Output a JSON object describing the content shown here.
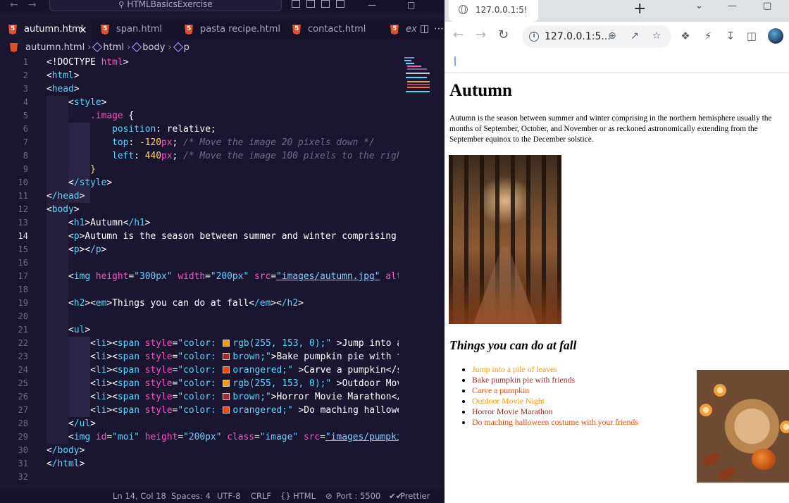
{
  "vscode": {
    "command_center": "HTMLBasicsExercise",
    "tabs": [
      {
        "label": "autumn.html",
        "active": true
      },
      {
        "label": "span.html"
      },
      {
        "label": "pasta recipe.html"
      },
      {
        "label": "contact.html"
      },
      {
        "label": "ex"
      }
    ],
    "breadcrumb": [
      "autumn.html",
      "html",
      "body",
      "p"
    ],
    "current_line": 14,
    "line_numbers": [
      "1",
      "2",
      "3",
      "4",
      "5",
      "6",
      "7",
      "8",
      "9",
      "10",
      "11",
      "12",
      "13",
      "14",
      "15",
      "16",
      "17",
      "18",
      "19",
      "20",
      "21",
      "22",
      "23",
      "24",
      "25",
      "26",
      "27",
      "28",
      "29",
      "30",
      "31",
      "32"
    ],
    "code": {
      "l1_doctype": "<!DOCTYPE",
      "l1_html": "html",
      "l1_close": ">",
      "l2": "html",
      "l3": "head",
      "l4": "style",
      "l5_sel": ".image",
      "l5_brace": " {",
      "l6_prop": "position",
      "l6_val": ": relative;",
      "l7_prop": "top",
      "l7_num": "-120",
      "l7_unit": "px",
      "l7_semi": ";",
      "l7_com": " /* Move the image 20 pixels down */",
      "l8_prop": "left",
      "l8_num": "440",
      "l8_unit": "px",
      "l8_semi": ";",
      "l8_com": " /* Move the image 100 pixels to the righ",
      "l9": "}",
      "l10": "/style",
      "l11": "/head",
      "l12": "body",
      "l13_open": "h1",
      "l13_text": "Autumn",
      "l13_close": "/h1",
      "l14_open": "p",
      "l14_text": "Autumn is the season between summer and winter comprising",
      "l15_open": "p",
      "l15_close": "/p",
      "l17_tag": "img",
      "l17_a1": "height",
      "l17_v1": "\"300px\"",
      "l17_a2": "width",
      "l17_v2": "\"200px\"",
      "l17_a3": "src",
      "l17_v3": "\"images/autumn.jpg\"",
      "l17_a4": "alt",
      "l19_h2": "h2",
      "l19_em": "em",
      "l19_text": "Things you can do at fall",
      "l19_cem": "/em",
      "l19_ch2": "/h2",
      "l21": "ul",
      "li_tag": "li",
      "span_tag": "span",
      "style_attr": "style",
      "color_prefix": "\"color: ",
      "l22_val": "rgb(255, 153, 0);\"",
      "l22_text": " >Jump into a",
      "l23_val": "brown;\"",
      "l23_text": ">Bake pumpkin pie with f",
      "l24_val": "orangered;\"",
      "l24_text": " >Carve a pumpkin</s",
      "l25_val": "rgb(255, 153, 0);\"",
      "l25_text": " >Outdoor Mov",
      "l26_val": "brown;\"",
      "l26_text": ">Horror Movie Marathon</",
      "l27_val": "orangered;\"",
      "l27_text": " >Do maching hallowe",
      "l28": "/ul",
      "l29_tag": "img",
      "l29_a1": "id",
      "l29_v1": "\"moi\"",
      "l29_a2": "height",
      "l29_v2": "\"200px\"",
      "l29_a3": "class",
      "l29_v3": "\"image\"",
      "l29_a4": "src",
      "l29_v4": "\"images/pumpkin",
      "l30": "/body",
      "l31": "/html"
    },
    "swatch_colors": {
      "orange": "#ff9900",
      "brown": "#a52a2a",
      "orangered": "#ff4500"
    },
    "status": {
      "position": "Ln 14, Col 18",
      "spaces": "Spaces: 4",
      "encoding": "UTF-8",
      "eol": "CRLF",
      "language": "HTML",
      "port": "Port : 5500",
      "prettier": "Prettier"
    }
  },
  "chrome": {
    "tab_title": "127.0.0.1:5!",
    "url": "127.0.0.1:5...",
    "page": {
      "h1": "Autumn",
      "paragraph": "Autumn is the season between summer and winter comprising in the northern hemisphere usually the months of September, October, and November or as reckoned astronomically extending from the September equinox to the December solstice.",
      "h2": "Things you can do at fall",
      "activities": [
        {
          "text": "Jump into a pile of leaves",
          "color": "#ff9900"
        },
        {
          "text": "Bake pumpkin pie with friends",
          "color": "#a52a2a"
        },
        {
          "text": "Carve a pumpkin",
          "color": "#ff4500"
        },
        {
          "text": "Outdoor Movie Night",
          "color": "#ff9900"
        },
        {
          "text": "Horror Movie Marathon",
          "color": "#a52a2a"
        },
        {
          "text": "Do maching halloween costume with your friends",
          "color": "#ff4500"
        }
      ]
    }
  }
}
